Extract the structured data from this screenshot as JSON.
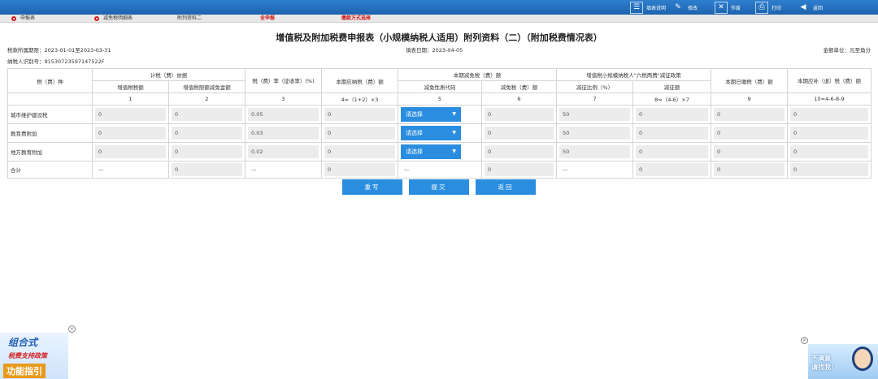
{
  "toolbar": {
    "items": [
      {
        "label": "填表说明",
        "icon": "instructions-icon"
      },
      {
        "label": "修改",
        "icon": "pencil-icon"
      },
      {
        "label": "作废",
        "icon": "void-icon"
      },
      {
        "label": "打印",
        "icon": "printer-icon"
      },
      {
        "label": "返回",
        "icon": "back-arrow-icon"
      }
    ]
  },
  "tabs": [
    {
      "label": "申报表"
    },
    {
      "label": "减免税明细表"
    },
    {
      "label": "附列资料二"
    },
    {
      "label": "全申报"
    },
    {
      "label": "缴款方式选择"
    }
  ],
  "title": "增值税及附加税费申报表（小规模纳税人适用）附列资料（二）（附加税费情况表）",
  "meta": {
    "period": "税款所属期限：2023-01-01至2023-03-31",
    "fill_date": "填表日期：2023-04-05",
    "unit": "金额单位：元至角分",
    "taxpayer_id": "纳税人识别号：91530723597147522F"
  },
  "table": {
    "h_tax_type": "税（费）种",
    "h_basis": "计税（费）依据",
    "h_vat": "增值税税额",
    "h_vat_deduct": "增值税限额减免金额",
    "h_rate": "税（费）率（征收率）(%)",
    "h_payable": "本期应纳税（费）额",
    "h_relief": "本期减免税（费）额",
    "h_relief_code": "减免性质代码",
    "h_relief_amount": "减免税（费）额",
    "h_policy": "增值税小规模纳税人\"六税两费\"减征政策",
    "h_policy_ratio": "减征比例（%）",
    "h_policy_amount": "减征额",
    "h_paid": "本期已缴税（费）额",
    "h_refund": "本期应补（退）税（费）额",
    "col_numbers": [
      "1",
      "2",
      "3",
      "4=（1+2）×3",
      "5",
      "6",
      "7",
      "8=（4-6）×7",
      "9",
      "10=4-6-8-9"
    ],
    "rows": [
      {
        "name": "城市维护建设税",
        "vat": "0",
        "deduct": "0",
        "rate": "0.05",
        "payable": "0",
        "code": "请选择",
        "relief": "0",
        "ratio": "50",
        "reduce": "0",
        "paid": "0",
        "refund": "0"
      },
      {
        "name": "教育费附加",
        "vat": "0",
        "deduct": "0",
        "rate": "0.03",
        "payable": "0",
        "code": "请选择",
        "relief": "0",
        "ratio": "50",
        "reduce": "0",
        "paid": "0",
        "refund": "0"
      },
      {
        "name": "地方教育附加",
        "vat": "0",
        "deduct": "0",
        "rate": "0.02",
        "payable": "0",
        "code": "请选择",
        "relief": "0",
        "ratio": "50",
        "reduce": "0",
        "paid": "0",
        "refund": "0"
      }
    ],
    "total": {
      "name": "合计",
      "vat": "—",
      "deduct": "0",
      "rate": "—",
      "payable": "0",
      "code": "—",
      "relief": "0",
      "ratio": "—",
      "reduce": "0",
      "paid": "0",
      "refund": "0"
    }
  },
  "actions": {
    "reset": "重写",
    "submit": "提交",
    "back": "返回"
  },
  "promo_left": {
    "line1": "组合式",
    "line2": "税费支持政策",
    "line3": "功能指引"
  },
  "promo_right": {
    "line1": "不满意",
    "line2": "请找我！"
  },
  "colors": {
    "toolbar": "#1d63ad",
    "button": "#2a8de0",
    "tab_dot": "#d31c1c",
    "cell_bg": "#ececec"
  }
}
